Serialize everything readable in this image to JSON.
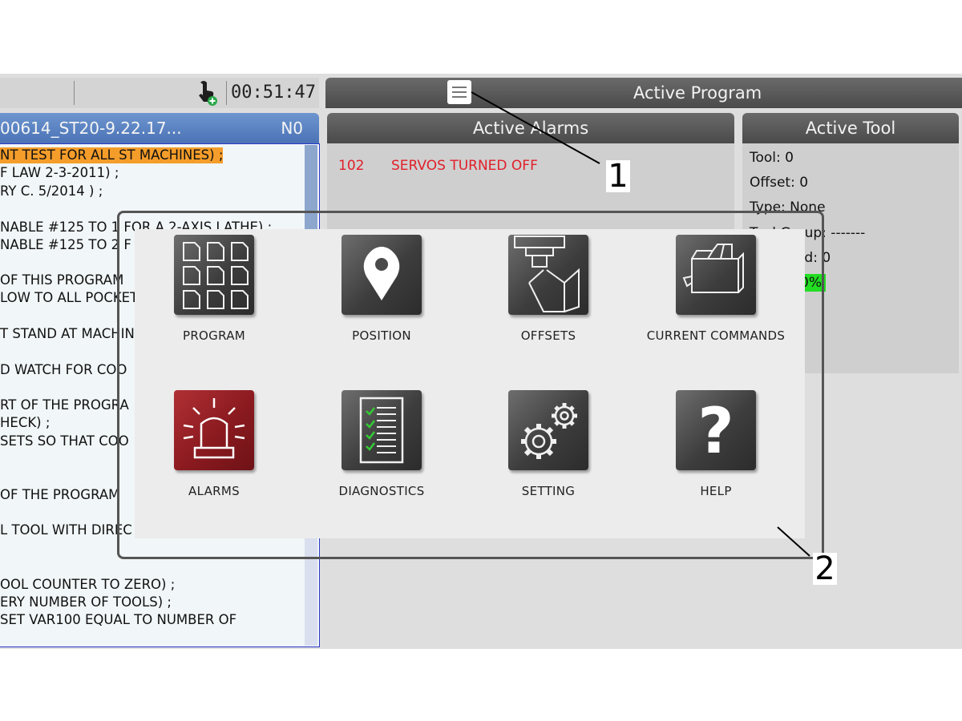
{
  "status_bar": {
    "clock": "00:51:47",
    "touch_icon": "touch-hand-icon"
  },
  "active_program": {
    "title": "Active Program",
    "menu_icon": "hamburger-menu-icon"
  },
  "program_panel": {
    "name": "00614_ST20-9.22.17...",
    "line_number": "N0",
    "lines": [
      "NT TEST FOR ALL ST MACHINES) ;",
      "F LAW 2-3-2011) ;",
      "RY C. 5/2014 ) ;",
      "",
      "NABLE #125 TO 1 FOR A 2-AXIS LATHE) ;",
      "NABLE #125 TO 2 F",
      "",
      "OF THIS PROGRAM",
      "LOW TO ALL POCKET",
      "",
      "T STAND AT MACHIN",
      "",
      "D WATCH FOR COO",
      "",
      "RT OF THE PROGRA",
      "HECK) ;",
      "SETS SO THAT COO",
      "",
      "",
      "OF THE PROGRAM",
      "",
      "L TOOL WITH DIREC",
      "",
      "",
      "OOL COUNTER TO ZERO) ;",
      "ERY NUMBER OF TOOLS) ;",
      "SET VAR100 EQUAL TO NUMBER OF"
    ]
  },
  "alarms_panel": {
    "title": "Active Alarms",
    "alarms": [
      {
        "code": "102",
        "text": "SERVOS TURNED OFF"
      }
    ],
    "alarm_color": "#e0202a"
  },
  "tool_panel": {
    "title": "Active Tool",
    "lines": [
      "Tool: 0",
      "Offset: 0",
      "Type: None",
      "Tool Group: -------",
      "Tool Load: 0"
    ],
    "percent": "0%",
    "percent_color": "#22dd22"
  },
  "home_menu": {
    "tiles": [
      {
        "label": "PROGRAM",
        "icon": "program-grid-icon"
      },
      {
        "label": "POSITION",
        "icon": "map-pin-icon"
      },
      {
        "label": "OFFSETS",
        "icon": "offsets-tool-icon"
      },
      {
        "label": "CURRENT COMMANDS",
        "icon": "current-commands-icon"
      },
      {
        "label": "ALARMS",
        "icon": "alarm-beacon-icon"
      },
      {
        "label": "DIAGNOSTICS",
        "icon": "diagnostics-checklist-icon"
      },
      {
        "label": "SETTING",
        "icon": "settings-gears-icon"
      },
      {
        "label": "HELP",
        "icon": "help-question-icon"
      }
    ]
  },
  "callouts": [
    "1",
    "2"
  ]
}
